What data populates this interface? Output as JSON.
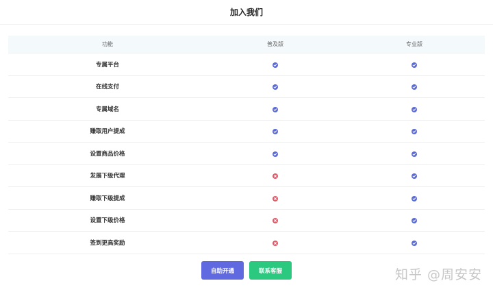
{
  "header": {
    "title": "加入我们"
  },
  "table": {
    "columns": [
      "功能",
      "普及版",
      "专业版"
    ],
    "rows": [
      {
        "feature": "专属平台",
        "basic": true,
        "pro": true
      },
      {
        "feature": "在线支付",
        "basic": true,
        "pro": true
      },
      {
        "feature": "专属域名",
        "basic": true,
        "pro": true
      },
      {
        "feature": "赚取用户提成",
        "basic": true,
        "pro": true
      },
      {
        "feature": "设置商品价格",
        "basic": true,
        "pro": true
      },
      {
        "feature": "发展下级代理",
        "basic": false,
        "pro": true
      },
      {
        "feature": "赚取下级提成",
        "basic": false,
        "pro": true
      },
      {
        "feature": "设置下级价格",
        "basic": false,
        "pro": true
      },
      {
        "feature": "签到更高奖励",
        "basic": false,
        "pro": true
      }
    ]
  },
  "actions": {
    "open_label": "自助开通",
    "contact_label": "联系客服"
  },
  "watermark": "知乎 @周安安",
  "colors": {
    "check": "#5b6bd5",
    "cross": "#e05a6a",
    "primary": "#6169e0",
    "success": "#2bc87f"
  }
}
